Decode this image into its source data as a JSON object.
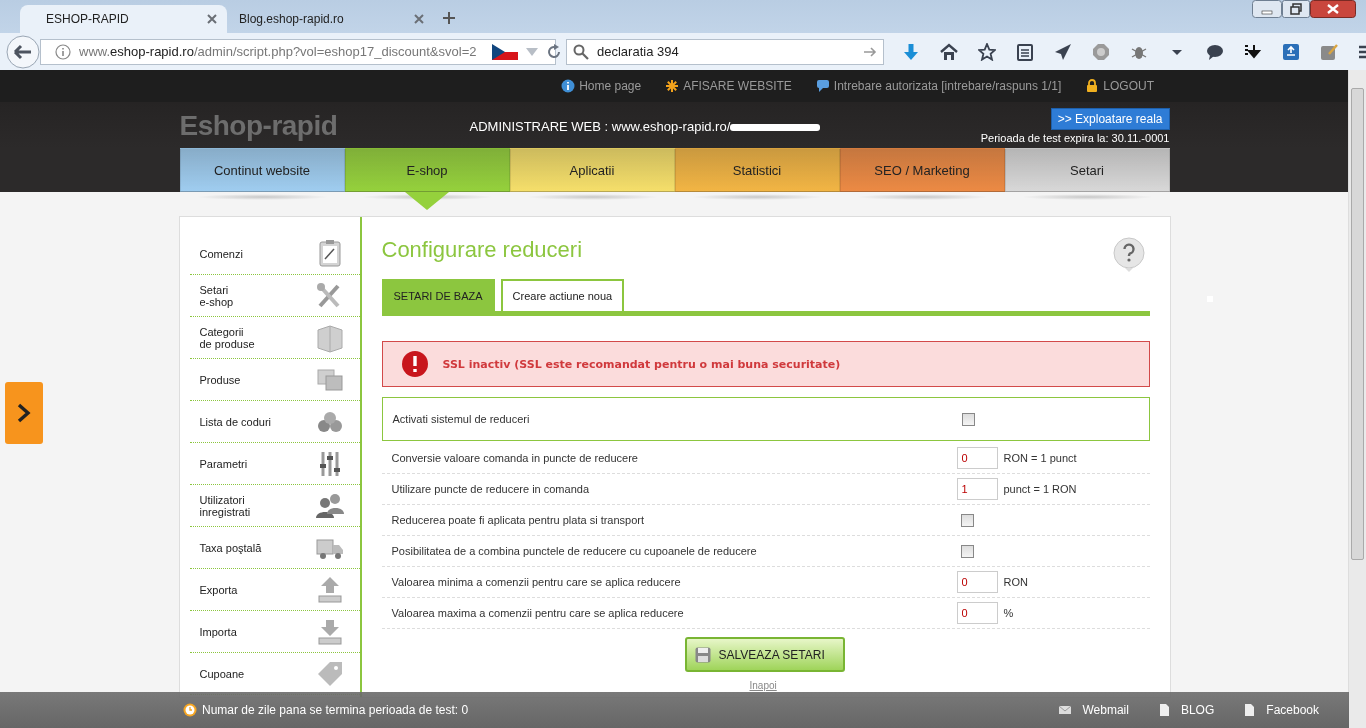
{
  "browser": {
    "tabs": [
      {
        "label": "ESHOP-RAPID",
        "selected": true
      },
      {
        "label": "Blog.eshop-rapid.ro",
        "selected": false
      }
    ],
    "url": {
      "prefix": "www.",
      "host": "eshop-rapid.ro",
      "path": "/admin/script.php?vol=eshop17_discount&svol=2"
    },
    "search": {
      "value": "declaratia 394"
    }
  },
  "top_links": [
    {
      "label": "Home page",
      "kind": "info"
    },
    {
      "label": "AFISARE WEBSITE",
      "kind": "star"
    },
    {
      "label": "Intrebare autorizata [intrebare/raspuns 1/1]",
      "kind": "chat"
    },
    {
      "label": "LOGOUT",
      "kind": "lock"
    }
  ],
  "header": {
    "logo": "Eshop-rapid",
    "admin_label": "ADMINISTRARE WEB : www.eshop-rapid.ro/",
    "live_button": ">> Exploatare reala",
    "test_expiry": "Perioada de test expira la: 30.11.-0001"
  },
  "nav": [
    {
      "label": "Continut website",
      "color": "#9fcdf0",
      "selected": false
    },
    {
      "label": "E-shop",
      "color": "#95d13c",
      "selected": true
    },
    {
      "label": "Aplicatii",
      "color": "#f5df6a",
      "selected": false
    },
    {
      "label": "Statistici",
      "color": "#f2b544",
      "selected": false
    },
    {
      "label": "SEO / Marketing",
      "color": "#ec8a44",
      "selected": false
    },
    {
      "label": "Setari",
      "color": "#d8d8d8",
      "selected": false
    }
  ],
  "sidebar": {
    "items": [
      {
        "label": "Comenzi",
        "kind": "clipboard"
      },
      {
        "label": "Setari\ne-shop",
        "kind": "tools"
      },
      {
        "label": "Categorii\nde produse",
        "kind": "box"
      },
      {
        "label": "Produse",
        "kind": "boxes"
      },
      {
        "label": "Lista de coduri",
        "kind": "coins"
      },
      {
        "label": "Parametri",
        "kind": "sliders"
      },
      {
        "label": "Utilizatori\ninregistrati",
        "kind": "users"
      },
      {
        "label": "Taxa poştală",
        "kind": "truck"
      },
      {
        "label": "Exporta",
        "kind": "upload"
      },
      {
        "label": "Importa",
        "kind": "download"
      },
      {
        "label": "Cupoane",
        "kind": "tag"
      }
    ]
  },
  "main": {
    "title": "Configurare reduceri",
    "tabs": [
      {
        "label": "SETARI DE BAZA",
        "selected": true
      },
      {
        "label": "Creare actiune noua",
        "selected": false
      }
    ],
    "alert": "SSL inactiv (SSL este recomandat pentru o mai buna securitate)",
    "settings": [
      {
        "kind": "checkbox",
        "label": "Activati sistemul de reduceri",
        "checked": false,
        "highlighted": true
      },
      {
        "kind": "input",
        "label": "Conversie valoare comanda in puncte de reducere",
        "value": "0",
        "unit": "RON = 1 punct"
      },
      {
        "kind": "input",
        "label": "Utilizare puncte de reducere in comanda",
        "value": "1",
        "unit": "punct = 1 RON"
      },
      {
        "kind": "checkbox",
        "label": "Reducerea poate fi aplicata pentru plata si transport",
        "checked": false,
        "highlighted": false
      },
      {
        "kind": "checkbox",
        "label": "Posibilitatea de a combina punctele de reducere cu cupoanele de reducere",
        "checked": false,
        "highlighted": false
      },
      {
        "kind": "input",
        "label": "Valoarea minima a comenzii pentru care se aplica reducere",
        "value": "0",
        "unit": "RON"
      },
      {
        "kind": "input",
        "label": "Valoarea maxima a comenzii pentru care se aplica reducere",
        "value": "0",
        "unit": "%"
      }
    ],
    "save_button": "SALVEAZA SETARI",
    "back_link": "Inapoi"
  },
  "footer": {
    "countdown": "Numar de zile pana se termina perioada de test: 0",
    "links": [
      {
        "label": "Webmail",
        "kind": "mail"
      },
      {
        "label": "BLOG",
        "kind": "doc"
      },
      {
        "label": "Facebook",
        "kind": "doc"
      }
    ]
  }
}
